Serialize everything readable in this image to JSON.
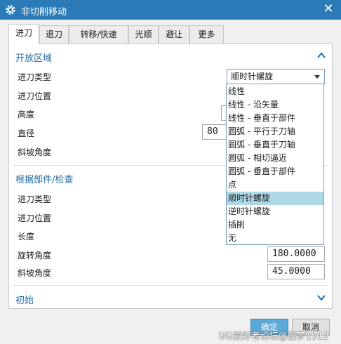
{
  "window": {
    "title": "非切削移动",
    "close_glyph": "✕"
  },
  "tabs": [
    {
      "label": "进刀"
    },
    {
      "label": "退刀"
    },
    {
      "label": "转移/快速"
    },
    {
      "label": "光顺"
    },
    {
      "label": "避让"
    },
    {
      "label": "更多"
    }
  ],
  "open_area": {
    "title": "开放区域",
    "labels": [
      "进刀类型",
      "进刀位置",
      "高度",
      "直径",
      "斜坡角度"
    ],
    "entry_type_value": "顺时针螺旋",
    "partial_value": "80"
  },
  "dropdown": {
    "options": [
      "线性",
      "线性 - 沿矢量",
      "线性 - 垂直于部件",
      "圆弧 - 平行于刀轴",
      "圆弧 - 垂直于刀轴",
      "圆弧 - 相切逼近",
      "圆弧 - 垂直于部件",
      "点",
      "顺时针螺旋",
      "逆时针螺旋",
      "插削",
      "无"
    ],
    "selected": "顺时针螺旋"
  },
  "check_area": {
    "title": "根据部件/检查",
    "labels": [
      "进刀类型",
      "进刀位置",
      "长度",
      "旋转角度",
      "斜坡角度"
    ],
    "rotation_value": "180.0000",
    "ramp_value": "45.0000"
  },
  "initial": {
    "title": "初始"
  },
  "buttons": {
    "ok": "确定",
    "cancel": "取消"
  },
  "watermark": "UG爱好者论坛@旧梦1512",
  "colors": {
    "titlebar": "#2b7bb9",
    "section_title": "#1f6ea6",
    "selected_option": "#add8e6"
  }
}
